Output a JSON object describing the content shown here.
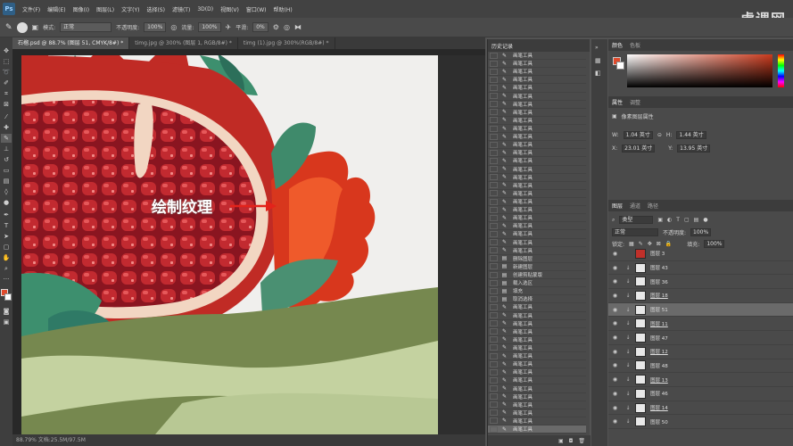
{
  "menubar": {
    "items": [
      "文件(F)",
      "编辑(E)",
      "图像(I)",
      "图层(L)",
      "文字(Y)",
      "选择(S)",
      "滤镜(T)",
      "3D(D)",
      "视图(V)",
      "窗口(W)",
      "帮助(H)"
    ]
  },
  "watermark": "虎课网",
  "options": {
    "mode_label": "模式:",
    "mode_value": "正常",
    "opacity_label": "不透明度:",
    "opacity_value": "100%",
    "flow_label": "流量:",
    "flow_value": "100%",
    "smooth_label": "平滑:",
    "smooth_value": "0%"
  },
  "tabs": [
    "石榴.psd @ 88.7% (图层 51, CMYK/8#) *",
    "timg.jpg @ 300% (图层 1, RGB/8#) *",
    "timg (1).jpg @ 300%(RGB/8#) *"
  ],
  "annotation": "绘制纹理",
  "statusbar": "88.79%   文档:25.5M/97.5M",
  "history": {
    "title": "历史记录",
    "items": [
      "画笔工具",
      "画笔工具",
      "画笔工具",
      "画笔工具",
      "画笔工具",
      "画笔工具",
      "画笔工具",
      "画笔工具",
      "画笔工具",
      "画笔工具",
      "画笔工具",
      "画笔工具",
      "画笔工具",
      "画笔工具",
      "画笔工具",
      "画笔工具",
      "画笔工具",
      "画笔工具",
      "画笔工具",
      "画笔工具",
      "画笔工具",
      "画笔工具",
      "画笔工具",
      "画笔工具",
      "画笔工具",
      "删除图层",
      "新建图层",
      "创建剪贴蒙版",
      "载入选区",
      "填充",
      "取消选择",
      "画笔工具",
      "画笔工具",
      "画笔工具",
      "画笔工具",
      "画笔工具",
      "画笔工具",
      "画笔工具",
      "画笔工具",
      "画笔工具",
      "画笔工具",
      "画笔工具",
      "画笔工具",
      "画笔工具",
      "画笔工具",
      "画笔工具",
      "画笔工具"
    ]
  },
  "color_panel": {
    "tabs": [
      "颜色",
      "色板"
    ]
  },
  "properties": {
    "tabs": [
      "属性",
      "调整"
    ],
    "type": "像素图层属性",
    "w_label": "W:",
    "w_value": "1.04 英寸",
    "h_label": "H:",
    "h_value": "1.44 英寸",
    "x_label": "X:",
    "x_value": "23.01 英寸",
    "y_label": "Y:",
    "y_value": "13.95 英寸"
  },
  "layers_panel": {
    "tabs": [
      "图层",
      "通道",
      "路径"
    ],
    "filter_value": "类型",
    "blend_value": "正常",
    "opacity_label": "不透明度:",
    "opacity_value": "100%",
    "lock_label": "锁定:",
    "fill_label": "填充:",
    "fill_value": "100%",
    "layers": [
      "图层 3",
      "图层 43",
      "图层 36",
      "图层 18",
      "图层 51",
      "图层 11",
      "图层 47",
      "图层 12",
      "图层 48",
      "图层 13",
      "图层 46",
      "图层 14",
      "图层 50"
    ]
  },
  "colors": {
    "accent": "#1473e6",
    "foreground": "#e04a2c",
    "background": "#ffffff",
    "gradient_hue": "#ca3a1d"
  }
}
